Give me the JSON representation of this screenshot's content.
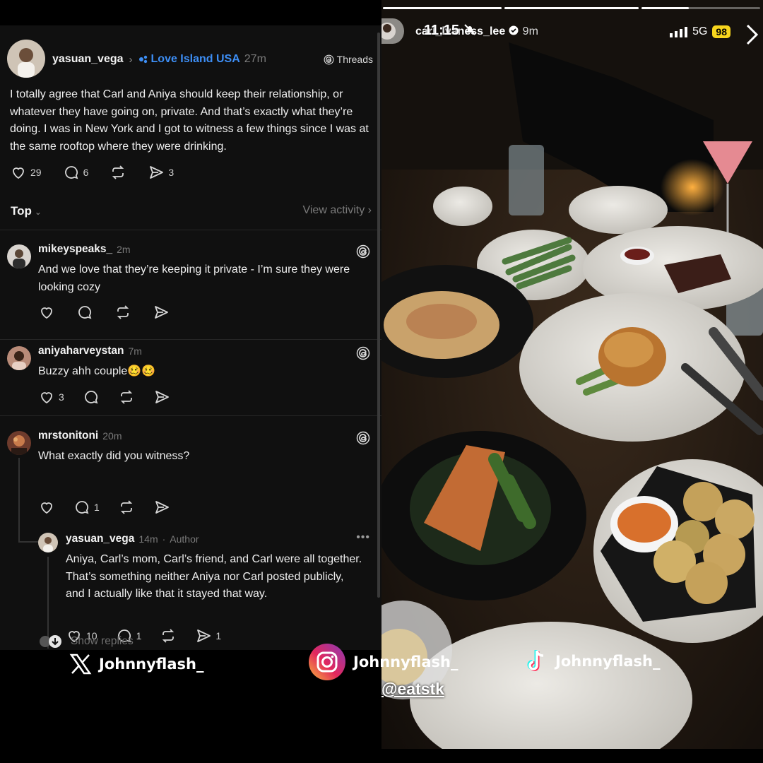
{
  "threads": {
    "post": {
      "username": "yasuan_vega",
      "community": "Love Island USA",
      "time": "27m",
      "app_badge": "Threads",
      "text": "I totally agree that Carl and Aniya should keep their relationship, or whatever they have going on, private. And that’s exactly what they’re doing. I was in New York and I got to witness a few things since I was at the same rooftop where they were drinking.",
      "likes": "29",
      "replies": "6",
      "shares": "3"
    },
    "sort": {
      "label": "Top",
      "view_activity": "View activity"
    },
    "comments": [
      {
        "username": "mikeyspeaks_",
        "time": "2m",
        "text": "And we love that they’re keeping it private - I’m sure they were looking cozy"
      },
      {
        "username": "aniyaharveystan",
        "time": "7m",
        "text": "Buzzy ahh couple🥴🥴",
        "likes": "3"
      },
      {
        "username": "mrstonitoni",
        "time": "20m",
        "text": "What exactly did you witness?",
        "replies": "1"
      }
    ],
    "reply": {
      "username": "yasuan_vega",
      "time": "14m",
      "author_tag": "Author",
      "text": "Aniya, Carl’s mom, Carl’s friend, and Carl were all together. That’s something neither Aniya nor Carl posted publicly, and I actually like that it stayed that way.",
      "likes": "10",
      "replies": "1",
      "shares": "1"
    },
    "show_replies": "Show replies"
  },
  "story": {
    "username": "carl_lvaness_lee",
    "time": "9m",
    "clock": "11:15",
    "network": "5G",
    "battery": "98",
    "tag": "@eatstk",
    "progress": [
      1,
      1,
      0.4,
      0
    ]
  },
  "watermarks": {
    "x": "Johnnyflash_",
    "instagram": "Johnnyflash_",
    "tiktok": "Johnnyflash_"
  },
  "colors": {
    "link_blue": "#3d8ef5",
    "battery_yellow": "#f7d51d",
    "panel_bg": "#101010"
  }
}
